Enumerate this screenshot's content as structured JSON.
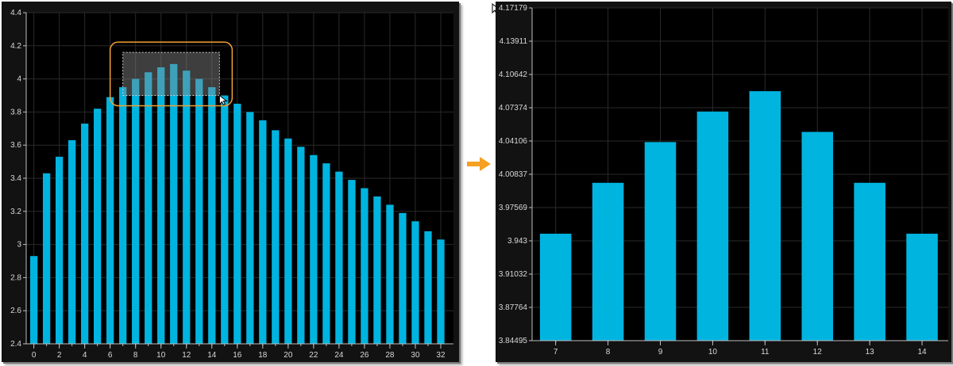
{
  "colors": {
    "bar": "#00b4e0",
    "background": "#000000",
    "grid": "#2a2a2a",
    "axis": "#bfbfbf",
    "text": "#d8d8d8",
    "selection_border": "#f0a030",
    "selection_fill": "#8a8a8a",
    "arrow": "#f5a020"
  },
  "icons": {
    "pointer": "mouse-pointer-icon",
    "arrow": "arrow-right-icon"
  },
  "chart_data": [
    {
      "type": "bar",
      "x": [
        0,
        1,
        2,
        3,
        4,
        5,
        6,
        7,
        8,
        9,
        10,
        11,
        12,
        13,
        14,
        15,
        16,
        17,
        18,
        19,
        20,
        21,
        22,
        23,
        24,
        25,
        26,
        27,
        28,
        29,
        30,
        31,
        32
      ],
      "values": [
        2.93,
        3.43,
        3.53,
        3.63,
        3.73,
        3.82,
        3.89,
        3.95,
        4.0,
        4.04,
        4.07,
        4.09,
        4.05,
        4.0,
        3.95,
        3.9,
        3.85,
        3.8,
        3.75,
        3.69,
        3.64,
        3.59,
        3.54,
        3.49,
        3.44,
        3.39,
        3.34,
        3.29,
        3.24,
        3.19,
        3.14,
        3.08,
        3.03
      ],
      "xticks": [
        "0",
        "2",
        "4",
        "6",
        "8",
        "10",
        "12",
        "14",
        "16",
        "18",
        "20",
        "22",
        "24",
        "26",
        "28",
        "30",
        "32"
      ],
      "yticks": [
        "2.4",
        "2.6",
        "2.8",
        "3",
        "3.2",
        "3.4",
        "3.6",
        "3.8",
        "4",
        "4.2",
        "4.4"
      ],
      "xlim": [
        -0.6,
        33.0
      ],
      "ylim": [
        2.4,
        4.4
      ],
      "grid": true,
      "selection_box": {
        "x_range": [
          7.0,
          14.6
        ],
        "y_range": [
          3.9,
          4.16
        ]
      }
    },
    {
      "type": "bar",
      "x": [
        7,
        8,
        9,
        10,
        11,
        12,
        13,
        14
      ],
      "values": [
        3.95,
        4.0,
        4.04,
        4.07,
        4.09,
        4.05,
        4.0,
        3.95
      ],
      "xticks": [
        "7",
        "8",
        "9",
        "10",
        "11",
        "12",
        "13",
        "14"
      ],
      "yticks": [
        "3.84495",
        "3.87764",
        "3.91032",
        "3.943",
        "3.97569",
        "4.00837",
        "4.04106",
        "4.07374",
        "4.10642",
        "4.13911",
        "4.17179"
      ],
      "xlim": [
        6.55,
        14.5
      ],
      "ylim": [
        3.84495,
        4.17179
      ],
      "grid": true
    }
  ]
}
